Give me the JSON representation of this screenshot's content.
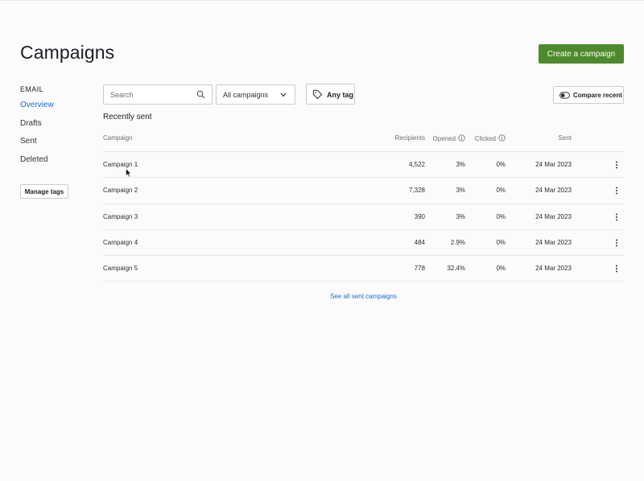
{
  "header": {
    "title": "Campaigns",
    "create_label": "Create a campaign",
    "create_color": "#4d8a2b"
  },
  "sidebar": {
    "heading": "EMAIL",
    "items": [
      {
        "label": "Overview",
        "active": true
      },
      {
        "label": "Drafts",
        "active": false
      },
      {
        "label": "Sent",
        "active": false
      },
      {
        "label": "Deleted",
        "active": false
      }
    ],
    "manage_tags_label": "Manage tags"
  },
  "filters": {
    "search_placeholder": "Search",
    "campaign_select": "All campaigns",
    "tag_label": "Any tag",
    "compare_label": "Compare recent"
  },
  "recent": {
    "title": "Recently sent",
    "columns": {
      "campaign": "Campaign",
      "recipients": "Recipients",
      "opened": "Opened",
      "clicked": "Clicked",
      "sent": "Sent"
    },
    "rows": [
      {
        "name": "Campaign 1",
        "recipients": "4,522",
        "opened": "3%",
        "clicked": "0%",
        "sent": "24 Mar 2023"
      },
      {
        "name": "Campaign 2",
        "recipients": "7,328",
        "opened": "3%",
        "clicked": "0%",
        "sent": "24 Mar 2023"
      },
      {
        "name": "Campaign 3",
        "recipients": "390",
        "opened": "3%",
        "clicked": "0%",
        "sent": "24 Mar 2023"
      },
      {
        "name": "Campaign 4",
        "recipients": "484",
        "opened": "2.9%",
        "clicked": "0%",
        "sent": "24 Mar 2023"
      },
      {
        "name": "Campaign 5",
        "recipients": "778",
        "opened": "32.4%",
        "clicked": "0%",
        "sent": "24 Mar 2023"
      }
    ],
    "see_all_label": "See all sent campaigns"
  },
  "icons": {
    "search": "search-icon",
    "chevron": "chevron-down-icon",
    "tag": "tag-icon",
    "toggle": "toggle-icon",
    "info": "info-icon",
    "more": "more-vertical-icon"
  },
  "colors": {
    "accent": "#1a6ad6",
    "primary_button": "#4d8a2b"
  }
}
